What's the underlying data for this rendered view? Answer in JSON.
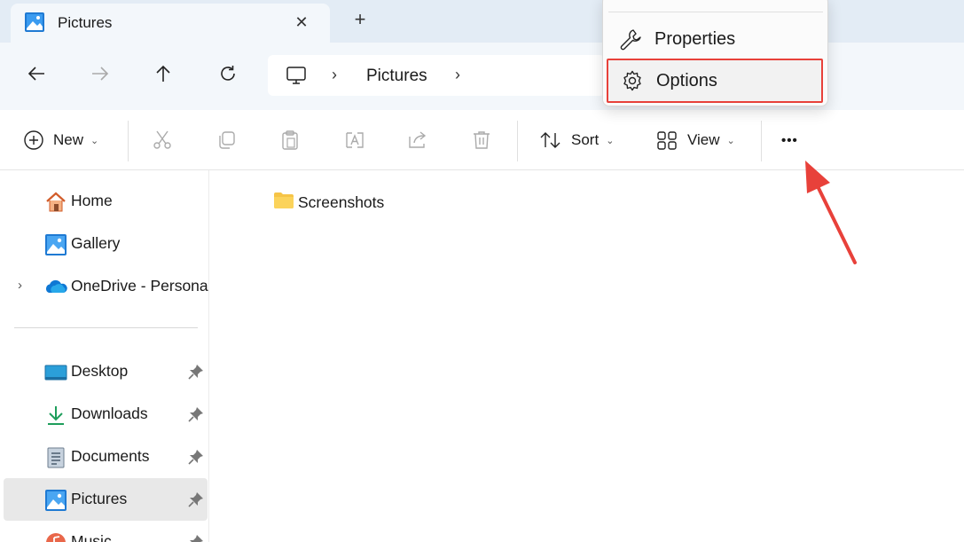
{
  "window": {
    "tab_title": "Pictures",
    "tab_close": "✕",
    "new_tab": "+"
  },
  "nav": {
    "back_icon": "arrow-left-icon",
    "forward_icon": "arrow-right-icon",
    "up_icon": "arrow-up-icon",
    "refresh_icon": "refresh-icon",
    "address": {
      "root_icon": "computer-icon",
      "separator": "›",
      "path": "Pictures"
    }
  },
  "commands": {
    "new": "New",
    "sort": "Sort",
    "view": "View",
    "more": "•••",
    "chevron": "⌄"
  },
  "menu": {
    "items": [
      {
        "label": "Properties",
        "icon": "wrench-icon"
      },
      {
        "label": "Options",
        "icon": "gear-icon",
        "highlighted": true
      }
    ]
  },
  "sidebar": {
    "items": [
      {
        "label": "Home",
        "icon": "home-icon"
      },
      {
        "label": "Gallery",
        "icon": "gallery-icon"
      },
      {
        "label": "OneDrive - Persona",
        "icon": "onedrive-icon",
        "expander": "›"
      },
      {
        "label": "Desktop",
        "icon": "desktop-icon",
        "pinned": true
      },
      {
        "label": "Downloads",
        "icon": "downloads-icon",
        "pinned": true
      },
      {
        "label": "Documents",
        "icon": "documents-icon",
        "pinned": true
      },
      {
        "label": "Pictures",
        "icon": "pictures-icon",
        "pinned": true,
        "selected": true
      },
      {
        "label": "Music",
        "icon": "music-icon",
        "pinned": true
      }
    ]
  },
  "content": {
    "items": [
      {
        "label": "Screenshots",
        "icon": "folder-icon"
      }
    ]
  },
  "colors": {
    "accent": "#0067c0",
    "annotation": "#e8413a",
    "folder": "#f6c447"
  }
}
